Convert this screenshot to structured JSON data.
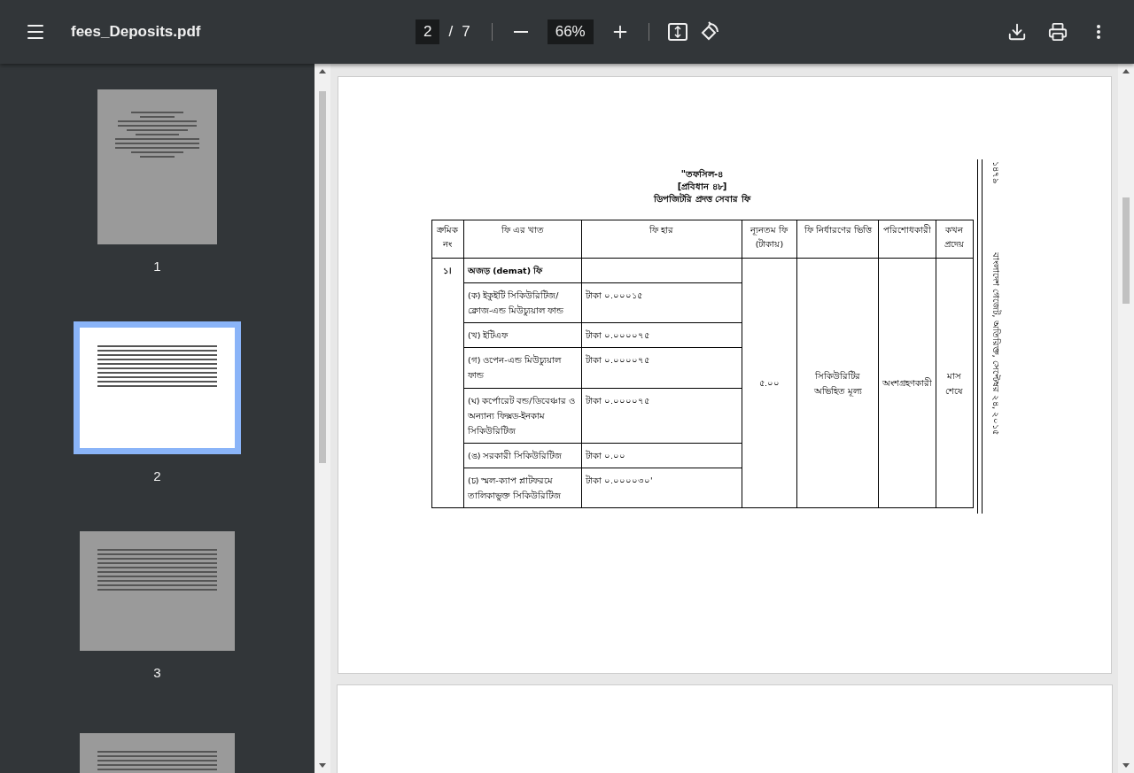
{
  "toolbar": {
    "title": "fees_Deposits.pdf",
    "page_current": "2",
    "page_separator": "/",
    "page_total": "7",
    "zoom": "66%"
  },
  "thumbnails": [
    {
      "label": "1",
      "selected": false,
      "kind": "portrait"
    },
    {
      "label": "2",
      "selected": true,
      "kind": "landscape"
    },
    {
      "label": "3",
      "selected": false,
      "kind": "landscape"
    },
    {
      "kind": "landscape",
      "selected": false
    }
  ],
  "document": {
    "title_lines": [
      "\"তফসিল-৪",
      "[প্রবিধান ৪৮]",
      "ডিপজিটরি প্রদত্ত সেবার ফি"
    ],
    "side_text": "বাংলাদেশ গেজেট, অতিরিক্ত, সেপ্টেম্বর ২৪, ২০১৫",
    "page_number": "১৪৭৯",
    "table": {
      "columns": [
        "ক্রমিক নং",
        "ফি এর খাত",
        "ফি হার",
        "ন্যূনতম ফি (টাকায়)",
        "ফি নির্ধারণের ভিত্তি",
        "পরিশোধকারী",
        "কখন প্রদেয়"
      ],
      "serial": "১।",
      "group_heading": "অজড় (demat) ফি",
      "items": [
        {
          "head": "(ক) ইকুইটি সিকিউরিটিজ/ ক্লোজ-এন্ড মিউচ্যুয়াল ফান্ড",
          "rate": "টাকা ০.০০০১৫"
        },
        {
          "head": "(খ) ইটিএফ",
          "rate": "টাকা ০.০০০০৭৫"
        },
        {
          "head": "(গ) ওপেন-এন্ড মিউচ্যুয়াল ফান্ড",
          "rate": "টাকা ০.০০০০৭৫"
        },
        {
          "head": "(ঘ) কর্পোরেট বন্ড/ডিবেঞ্চার ও অন্যান্য ফিক্সড-ইনকাম সিকিউরিটিজ",
          "rate": "টাকা ০.০০০০৭৫"
        },
        {
          "head": "(ঙ) সরকারী সিকিউরিটিজ",
          "rate": "টাকা ০.০০"
        },
        {
          "head": "(চ) স্মল-ক্যাপ প্লাটফরমে তালিকাভুক্ত সিকিউরিটিজ",
          "rate": "টাকা ০.০০০০৩০'"
        }
      ],
      "min_fee": "৫.০০",
      "basis": "সিকিউরিটির অভিহিত মূল্য",
      "payer": "অংশগ্রহণকারী",
      "when": "মাস শেষে"
    }
  }
}
